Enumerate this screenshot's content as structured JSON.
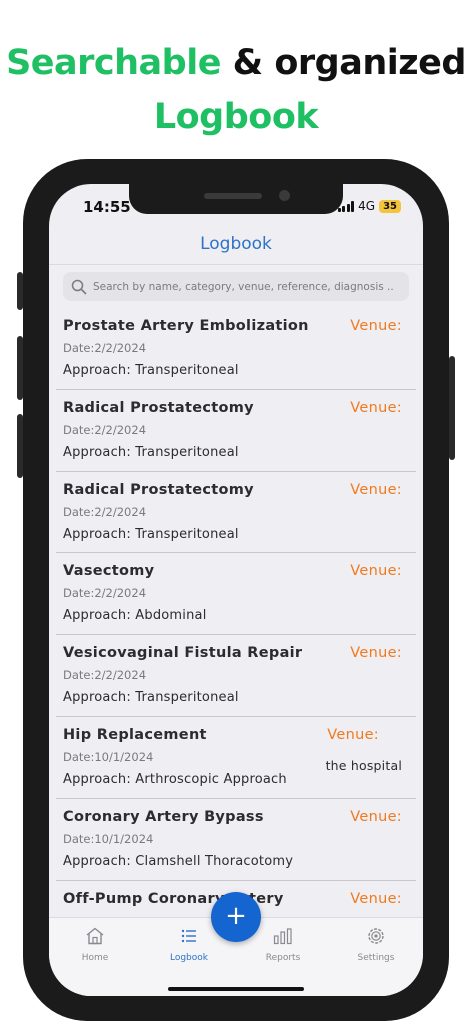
{
  "headline": {
    "line1_green": "Searchable",
    "line1_black": "& organized",
    "line2_green": "Logbook"
  },
  "colors": {
    "accent_green": "#1fbf64",
    "brand_blue": "#2f72c6",
    "venue_orange": "#f07a1e",
    "fab_blue": "#1565d0"
  },
  "status": {
    "time": "14:55",
    "network": "4G",
    "battery": "35"
  },
  "header": {
    "title": "Logbook"
  },
  "search": {
    "placeholder": "Search by name, category, venue, reference, diagnosis ..."
  },
  "entries": [
    {
      "name": "Prostate Artery Embolization",
      "date": "Date:2/2/2024",
      "approach": "Approach: Transperitoneal",
      "venue_label": "Venue:",
      "venue": ""
    },
    {
      "name": "Radical Prostatectomy",
      "date": "Date:2/2/2024",
      "approach": "Approach: Transperitoneal",
      "venue_label": "Venue:",
      "venue": ""
    },
    {
      "name": "Radical Prostatectomy",
      "date": "Date:2/2/2024",
      "approach": "Approach: Transperitoneal",
      "venue_label": "Venue:",
      "venue": ""
    },
    {
      "name": "Vasectomy",
      "date": "Date:2/2/2024",
      "approach": "Approach: Abdominal",
      "venue_label": "Venue:",
      "venue": ""
    },
    {
      "name": "Vesicovaginal Fistula Repair",
      "date": "Date:2/2/2024",
      "approach": "Approach: Transperitoneal",
      "venue_label": "Venue:",
      "venue": ""
    },
    {
      "name": "Hip Replacement",
      "date": "Date:10/1/2024",
      "approach": "Approach: Arthroscopic Approach",
      "venue_label": "Venue:",
      "venue": "the hospital"
    },
    {
      "name": "Coronary Artery Bypass",
      "date": "Date:10/1/2024",
      "approach": "Approach: Clamshell Thoracotomy",
      "venue_label": "Venue:",
      "venue": ""
    },
    {
      "name": "Off-Pump Coronary Artery",
      "date": "",
      "approach": "",
      "venue_label": "Venue:",
      "venue": ""
    }
  ],
  "fab": {
    "label": "+"
  },
  "tabs": [
    {
      "label": "Home",
      "icon": "home-icon",
      "active": false
    },
    {
      "label": "Logbook",
      "icon": "list-icon",
      "active": true
    },
    {
      "label": "Reports",
      "icon": "bar-chart-icon",
      "active": false
    },
    {
      "label": "Settings",
      "icon": "gear-icon",
      "active": false
    }
  ]
}
